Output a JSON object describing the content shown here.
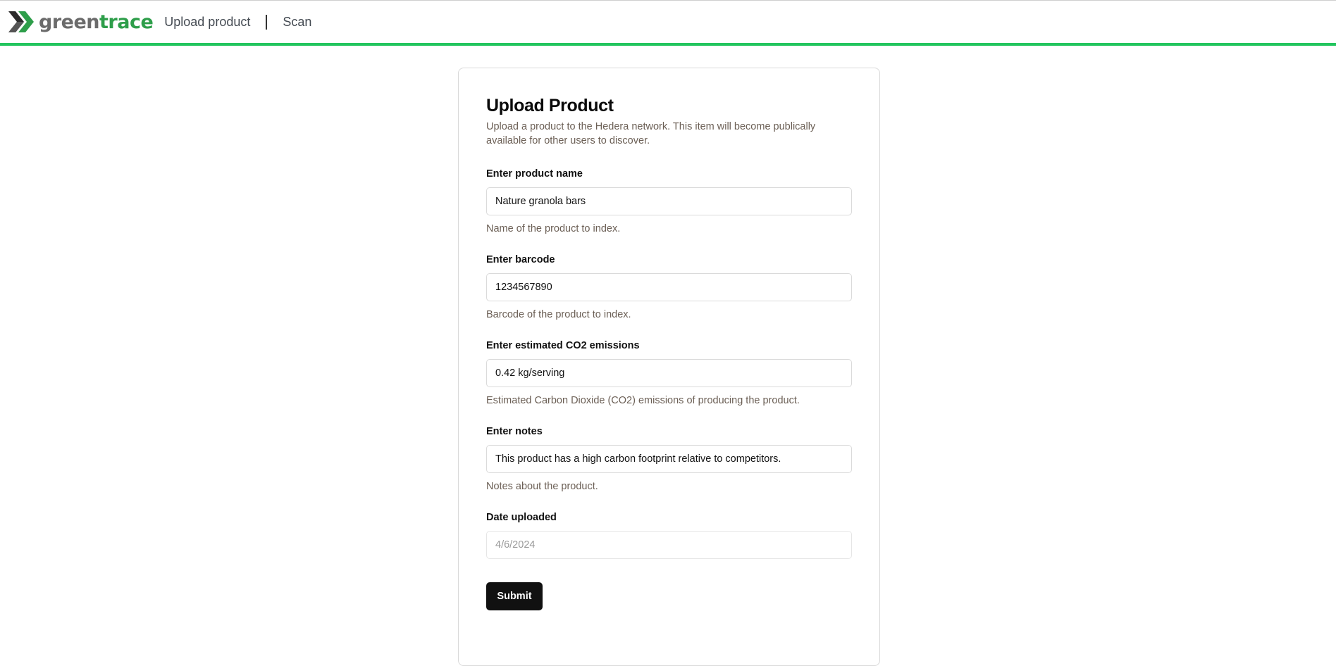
{
  "header": {
    "logo": {
      "word_green": "green",
      "word_trace": "trace",
      "icon": "chevron-arrows-icon"
    },
    "nav": [
      {
        "label": "Upload product"
      },
      {
        "label": "Scan"
      }
    ],
    "accent_color": "#22c55e"
  },
  "form": {
    "title": "Upload Product",
    "description": "Upload a product to the Hedera network. This item will become publically available for other users to discover.",
    "fields": [
      {
        "label": "Enter product name",
        "value": "Nature granola bars",
        "help": "Name of the product to index."
      },
      {
        "label": "Enter barcode",
        "value": "1234567890",
        "help": "Barcode of the product to index."
      },
      {
        "label": "Enter estimated CO2 emissions",
        "value": "0.42 kg/serving",
        "help": "Estimated Carbon Dioxide (CO2) emissions of producing the product."
      },
      {
        "label": "Enter notes",
        "value": "This product has a high carbon footprint relative to competitors.",
        "help": "Notes about the product."
      },
      {
        "label": "Date uploaded",
        "value": "4/6/2024"
      }
    ],
    "submit_label": "Submit"
  }
}
